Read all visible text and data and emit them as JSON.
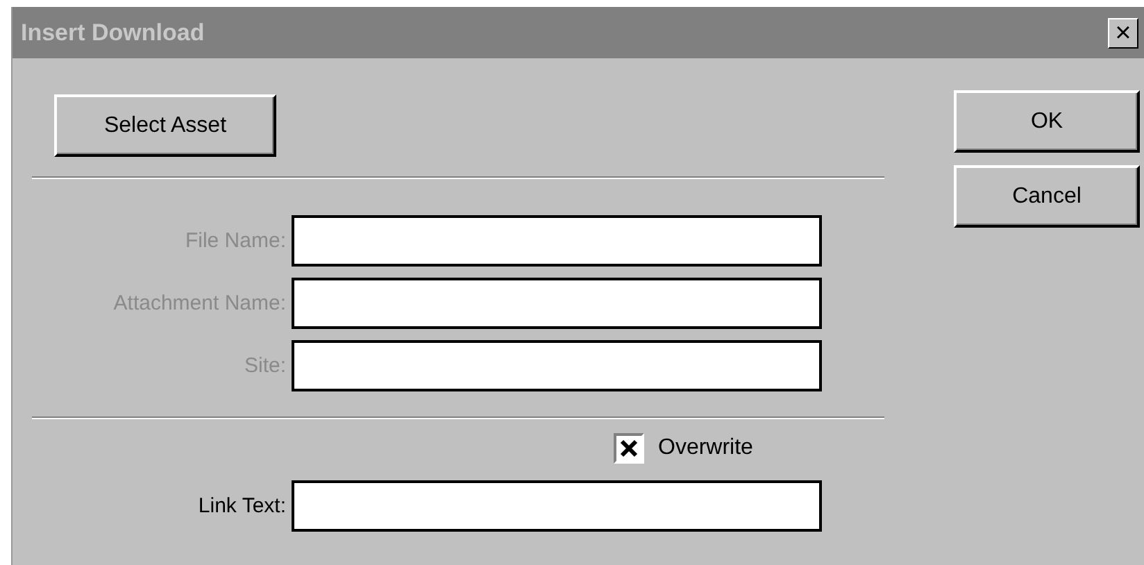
{
  "window": {
    "title": "Insert Download",
    "close": "×"
  },
  "select_button": "Select Asset",
  "fields": [
    {
      "label": "File Name:",
      "disabled": true
    },
    {
      "label": "Attachment Name:",
      "disabled": true
    },
    {
      "label": "Site:",
      "disabled": true
    }
  ],
  "overwrite": {
    "label": "Overwrite",
    "checked": true
  },
  "link_text": {
    "label": "Link Text:",
    "disabled": false
  },
  "buttons": [
    "OK",
    "Cancel"
  ]
}
